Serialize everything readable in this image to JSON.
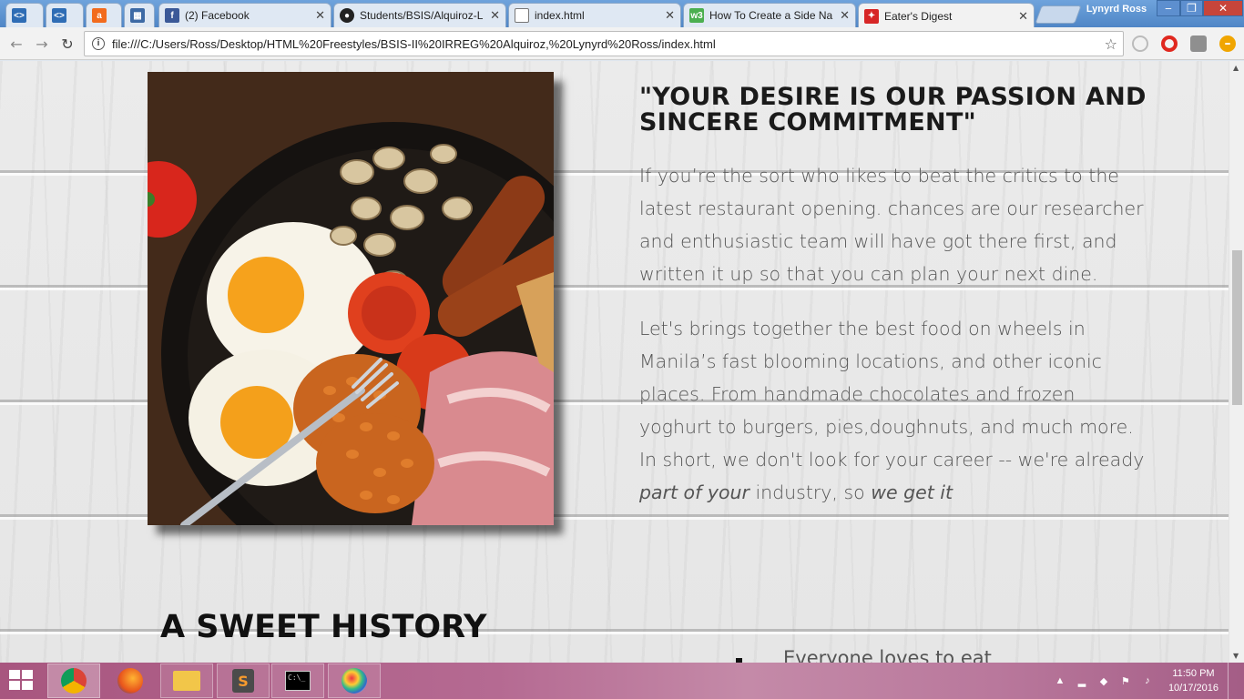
{
  "browser": {
    "tabs": [
      {
        "label": "",
        "icon": "code-icon",
        "color": "#2f6db5"
      },
      {
        "label": "",
        "icon": "code-icon",
        "color": "#2f6db5"
      },
      {
        "label": "",
        "icon": "avast-icon",
        "color": "#f26b1d"
      },
      {
        "label": "",
        "icon": "grid-icon",
        "color": "#3d6aa5"
      },
      {
        "label": "(2) Facebook",
        "icon": "facebook-icon",
        "color": "#3b5998"
      },
      {
        "label": "Students/BSIS/Alquiroz-L",
        "icon": "github-icon",
        "color": "#222222"
      },
      {
        "label": "index.html",
        "icon": "file-icon",
        "color": "#777777"
      },
      {
        "label": "How To Create a Side Na",
        "icon": "w3schools-icon",
        "color": "#4caf50"
      },
      {
        "label": "Eater's Digest",
        "icon": "eaters-digest-icon",
        "color": "#d72626"
      }
    ],
    "user_name": "Lynyrd Ross",
    "url": "file:///C:/Users/Ross/Desktop/HTML%20Freestyles/BSIS-II%20IRREG%20Alquiroz,%20Lynyrd%20Ross/index.html"
  },
  "page": {
    "quote": "\"YOUR DESIRE IS OUR PASSION AND SINCERE COMMITMENT\"",
    "para1": "If you’re the sort who likes to beat the critics to the latest restaurant opening. chances are our researcher and enthusiastic team will have got there first, and written it up so that you can plan your next dine.",
    "para2_main": "Let's brings together the best food on wheels in Manila’s fast blooming locations, and other iconic places. From handmade chocolates and frozen yoghurt to burgers, pies,doughnuts, and much more. In short, we don't look for your career -- we're already ",
    "para2_em1": "part of your",
    "para2_mid": " industry, so ",
    "para2_em2": "we get it",
    "history_heading": "A SWEET HISTORY",
    "history_list_first": "Everyone loves to eat"
  },
  "taskbar": {
    "time": "11:50 PM",
    "date": "10/17/2016",
    "apps": [
      "chrome-icon",
      "firefox-icon",
      "file-explorer-icon",
      "sublime-text-icon",
      "command-prompt-icon",
      "paint-icon"
    ]
  }
}
